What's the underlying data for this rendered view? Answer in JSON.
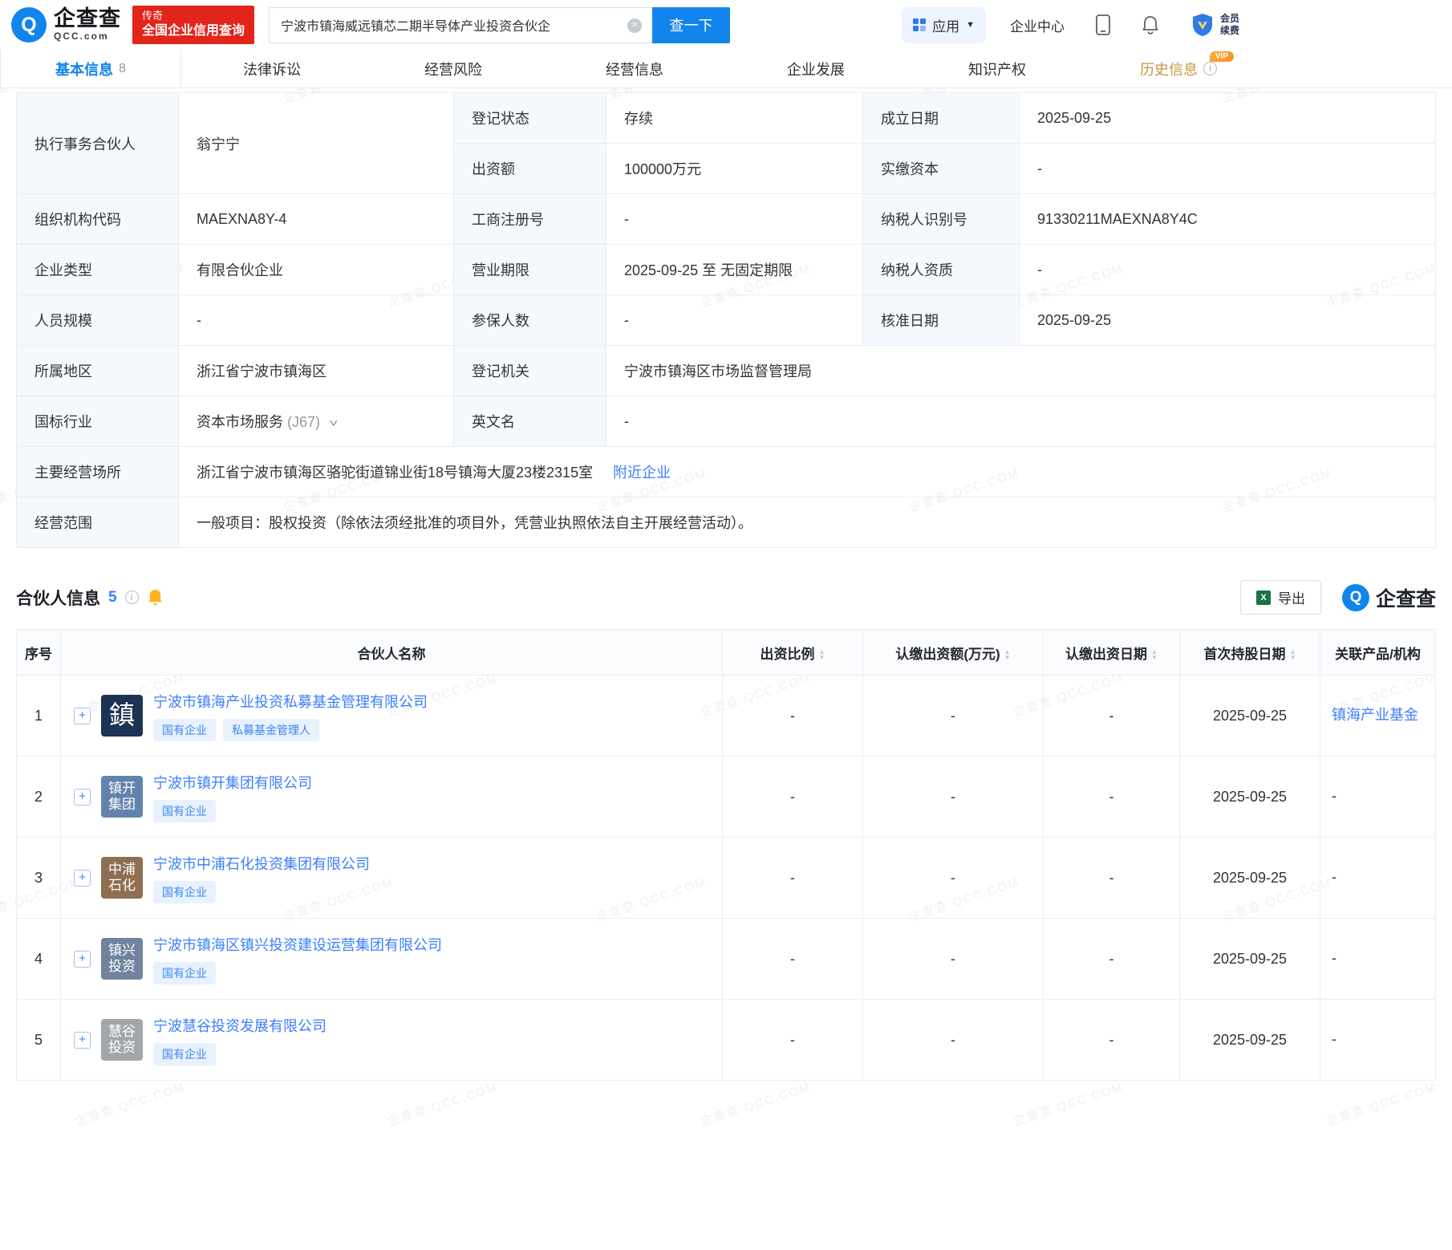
{
  "watermark": "企查查 QCC.COM",
  "header": {
    "logo_text": "企查查",
    "logo_sub": "QCC.com",
    "promo_line1": "传奇",
    "promo_line2": "全国企业信用查询",
    "search_value": "宁波市镇海威远镇芯二期半导体产业投资合伙企",
    "search_button": "查一下",
    "nav_app": "应用",
    "nav_center": "企业中心",
    "member_line1": "会员",
    "member_line2": "续费"
  },
  "tabs": [
    {
      "key": "basic-info",
      "label": "基本信息",
      "count": "8",
      "active": true
    },
    {
      "key": "legal",
      "label": "法律诉讼"
    },
    {
      "key": "risk",
      "label": "经营风险"
    },
    {
      "key": "operation",
      "label": "经营信息"
    },
    {
      "key": "development",
      "label": "企业发展"
    },
    {
      "key": "ip",
      "label": "知识产权"
    },
    {
      "key": "history",
      "label": "历史信息",
      "vip": "VIP",
      "info": true
    }
  ],
  "basic": {
    "exec_partner_label": "执行事务合伙人",
    "exec_partner_value": "翁宁宁",
    "reg_status_label": "登记状态",
    "reg_status_value": "存续",
    "establish_date_label": "成立日期",
    "establish_date_value": "2025-09-25",
    "capital_label": "出资额",
    "capital_value": "100000万元",
    "paid_capital_label": "实缴资本",
    "paid_capital_value": "-",
    "org_code_label": "组织机构代码",
    "org_code_value": "MAEXNA8Y-4",
    "reg_no_label": "工商注册号",
    "reg_no_value": "-",
    "tax_id_label": "纳税人识别号",
    "tax_id_value": "91330211MAEXNA8Y4C",
    "company_type_label": "企业类型",
    "company_type_value": "有限合伙企业",
    "term_label": "营业期限",
    "term_value": "2025-09-25 至 无固定期限",
    "tax_qual_label": "纳税人资质",
    "tax_qual_value": "-",
    "staff_label": "人员规模",
    "staff_value": "-",
    "insured_label": "参保人数",
    "insured_value": "-",
    "approval_label": "核准日期",
    "approval_value": "2025-09-25",
    "region_label": "所属地区",
    "region_value": "浙江省宁波市镇海区",
    "authority_label": "登记机关",
    "authority_value": "宁波市镇海区市场监督管理局",
    "industry_label": "国标行业",
    "industry_value": "资本市场服务",
    "industry_code": "(J67)",
    "en_name_label": "英文名",
    "en_name_value": "-",
    "address_label": "主要经营场所",
    "address_value": "浙江省宁波市镇海区骆驼街道锦业街18号镇海大厦23楼2315室",
    "nearby_link": "附近企业",
    "scope_label": "经营范围",
    "scope_value": "一般项目：股权投资（除依法须经批准的项目外，凭营业执照依法自主开展经营活动）。"
  },
  "partners": {
    "title": "合伙人信息",
    "count": "5",
    "export_label": "导出",
    "brand": "企查查",
    "columns": [
      {
        "key": "no",
        "label": "序号",
        "sortable": false
      },
      {
        "key": "name",
        "label": "合伙人名称",
        "sortable": false
      },
      {
        "key": "ratio",
        "label": "出资比例",
        "sortable": true
      },
      {
        "key": "amount",
        "label": "认缴出资额(万元)",
        "sortable": true
      },
      {
        "key": "sub-date",
        "label": "认缴出资日期",
        "sortable": true
      },
      {
        "key": "first-date",
        "label": "首次持股日期",
        "sortable": true
      },
      {
        "key": "related",
        "label": "关联产品/机构",
        "sortable": false
      }
    ],
    "rows": [
      {
        "no": "1",
        "name": "宁波市镇海产业投资私募基金管理有限公司",
        "tags": [
          "国有企业",
          "私募基金管理人"
        ],
        "logo_lines": [
          "鎮"
        ],
        "logo_bg": "#1d3354",
        "ratio": "-",
        "amount": "-",
        "sub_date": "-",
        "first_date": "2025-09-25",
        "related": "镇海产业基金",
        "related_is_link": true
      },
      {
        "no": "2",
        "name": "宁波市镇开集团有限公司",
        "tags": [
          "国有企业"
        ],
        "logo_lines": [
          "镇开",
          "集团"
        ],
        "logo_bg": "#6283ad",
        "ratio": "-",
        "amount": "-",
        "sub_date": "-",
        "first_date": "2025-09-25",
        "related": "-",
        "related_is_link": false
      },
      {
        "no": "3",
        "name": "宁波市中浦石化投资集团有限公司",
        "tags": [
          "国有企业"
        ],
        "logo_lines": [
          "中浦",
          "石化"
        ],
        "logo_bg": "#8f6e51",
        "ratio": "-",
        "amount": "-",
        "sub_date": "-",
        "first_date": "2025-09-25",
        "related": "-",
        "related_is_link": false
      },
      {
        "no": "4",
        "name": "宁波市镇海区镇兴投资建设运营集团有限公司",
        "tags": [
          "国有企业"
        ],
        "logo_lines": [
          "镇兴",
          "投资"
        ],
        "logo_bg": "#70849f",
        "ratio": "-",
        "amount": "-",
        "sub_date": "-",
        "first_date": "2025-09-25",
        "related": "-",
        "related_is_link": false
      },
      {
        "no": "5",
        "name": "宁波慧谷投资发展有限公司",
        "tags": [
          "国有企业"
        ],
        "logo_lines": [
          "慧谷",
          "投资"
        ],
        "logo_bg": "#a3a7ab",
        "ratio": "-",
        "amount": "-",
        "sub_date": "-",
        "first_date": "2025-09-25",
        "related": "-",
        "related_is_link": false
      }
    ]
  },
  "colors": {
    "brand_blue": "#1285ec",
    "link_blue": "#3d7eff",
    "promo_red": "#e1251b",
    "label_bg": "#f5f9fd",
    "border": "#e9edf3",
    "vip_orange": "#ff9726"
  }
}
